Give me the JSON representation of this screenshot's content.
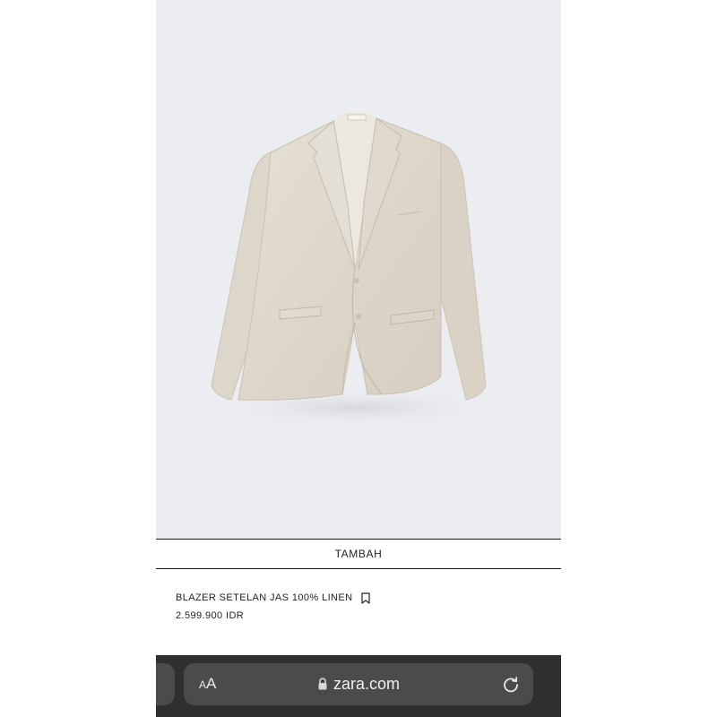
{
  "product": {
    "add_label": "TAMBAH",
    "name": "BLAZER SETELAN JAS 100% LINEN",
    "price": "2.599.900 IDR",
    "image_icon": "blazer-photo"
  },
  "browser": {
    "text_size_large": "A",
    "text_size_small": "A",
    "url": "zara.com",
    "icons": [
      "lock-icon",
      "reload-icon",
      "bookmark-icon"
    ]
  },
  "colors": {
    "image_background": "#ecedf1",
    "blazer": "#e2dcd0",
    "toolbar": "#2f2f31",
    "url_pill": "#4b4b4e"
  }
}
